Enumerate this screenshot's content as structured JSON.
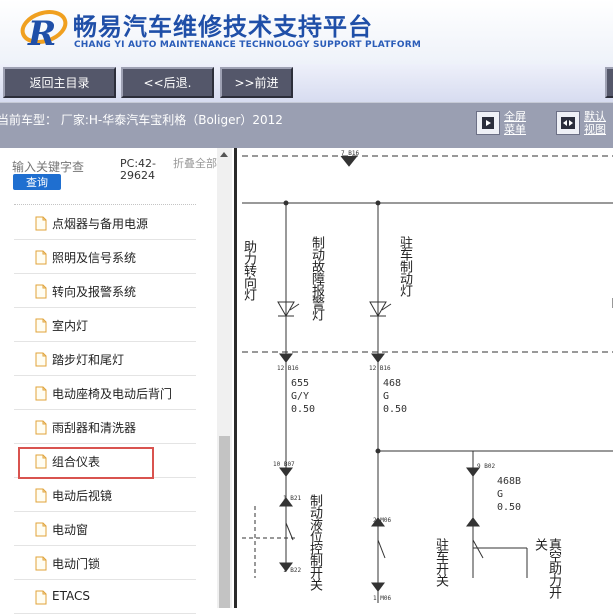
{
  "header": {
    "title": "畅易汽车维修技术支持平台",
    "subtitle": "CHANG YI AUTO MAINTENANCE TECHNOLOGY SUPPORT PLATFORM"
  },
  "nav": {
    "home": "返回主目录",
    "back": "<<后退.",
    "forward": ">>前进"
  },
  "status": {
    "vehicle": "当前车型：  厂家:H-华泰汽车宝利格（Boliger）2012",
    "fullscreen": "全屏菜单",
    "default_view": "默认视图"
  },
  "sidebar": {
    "search_placeholder": "输入关键字查",
    "search_button": "查询",
    "pc_code": "PC:42-29624",
    "collapse_all": "折叠全部",
    "items": [
      {
        "label": "点烟器与备用电源"
      },
      {
        "label": "照明及信号系统"
      },
      {
        "label": "转向及报警系统"
      },
      {
        "label": "室内灯"
      },
      {
        "label": "踏步灯和尾灯"
      },
      {
        "label": "电动座椅及电动后背门"
      },
      {
        "label": "雨刮器和清洗器"
      },
      {
        "label": "组合仪表"
      },
      {
        "label": "电动后视镜"
      },
      {
        "label": "电动窗"
      },
      {
        "label": "电动门锁"
      },
      {
        "label": "ETACS"
      }
    ]
  },
  "diagram": {
    "top_code": "7 B16",
    "label_turn": "助力转向灯",
    "label_brake_fault": "制动故障报警灯",
    "label_parking": "驻车制动灯",
    "conn1": "12 B16",
    "conn2": "12 B16",
    "wire1": [
      "655",
      "G/Y",
      "0.50"
    ],
    "wire2": [
      "468",
      "G",
      "0.50"
    ],
    "wire3": [
      "468B",
      "G",
      "0.50"
    ],
    "conn3": "10 B07",
    "conn4": "9 B02",
    "conn5": "1 B21",
    "conn6": "2 M06",
    "conn7": "1 B22",
    "conn8": "1 M06",
    "label_fluid_switch": "制动液位控制开关",
    "label_park_switch": "驻车开关",
    "label_vacuum": "真空助力开关",
    "colors": {
      "line": "#333333",
      "highlight": "#d9534f",
      "accent": "#1f6fd0"
    }
  }
}
